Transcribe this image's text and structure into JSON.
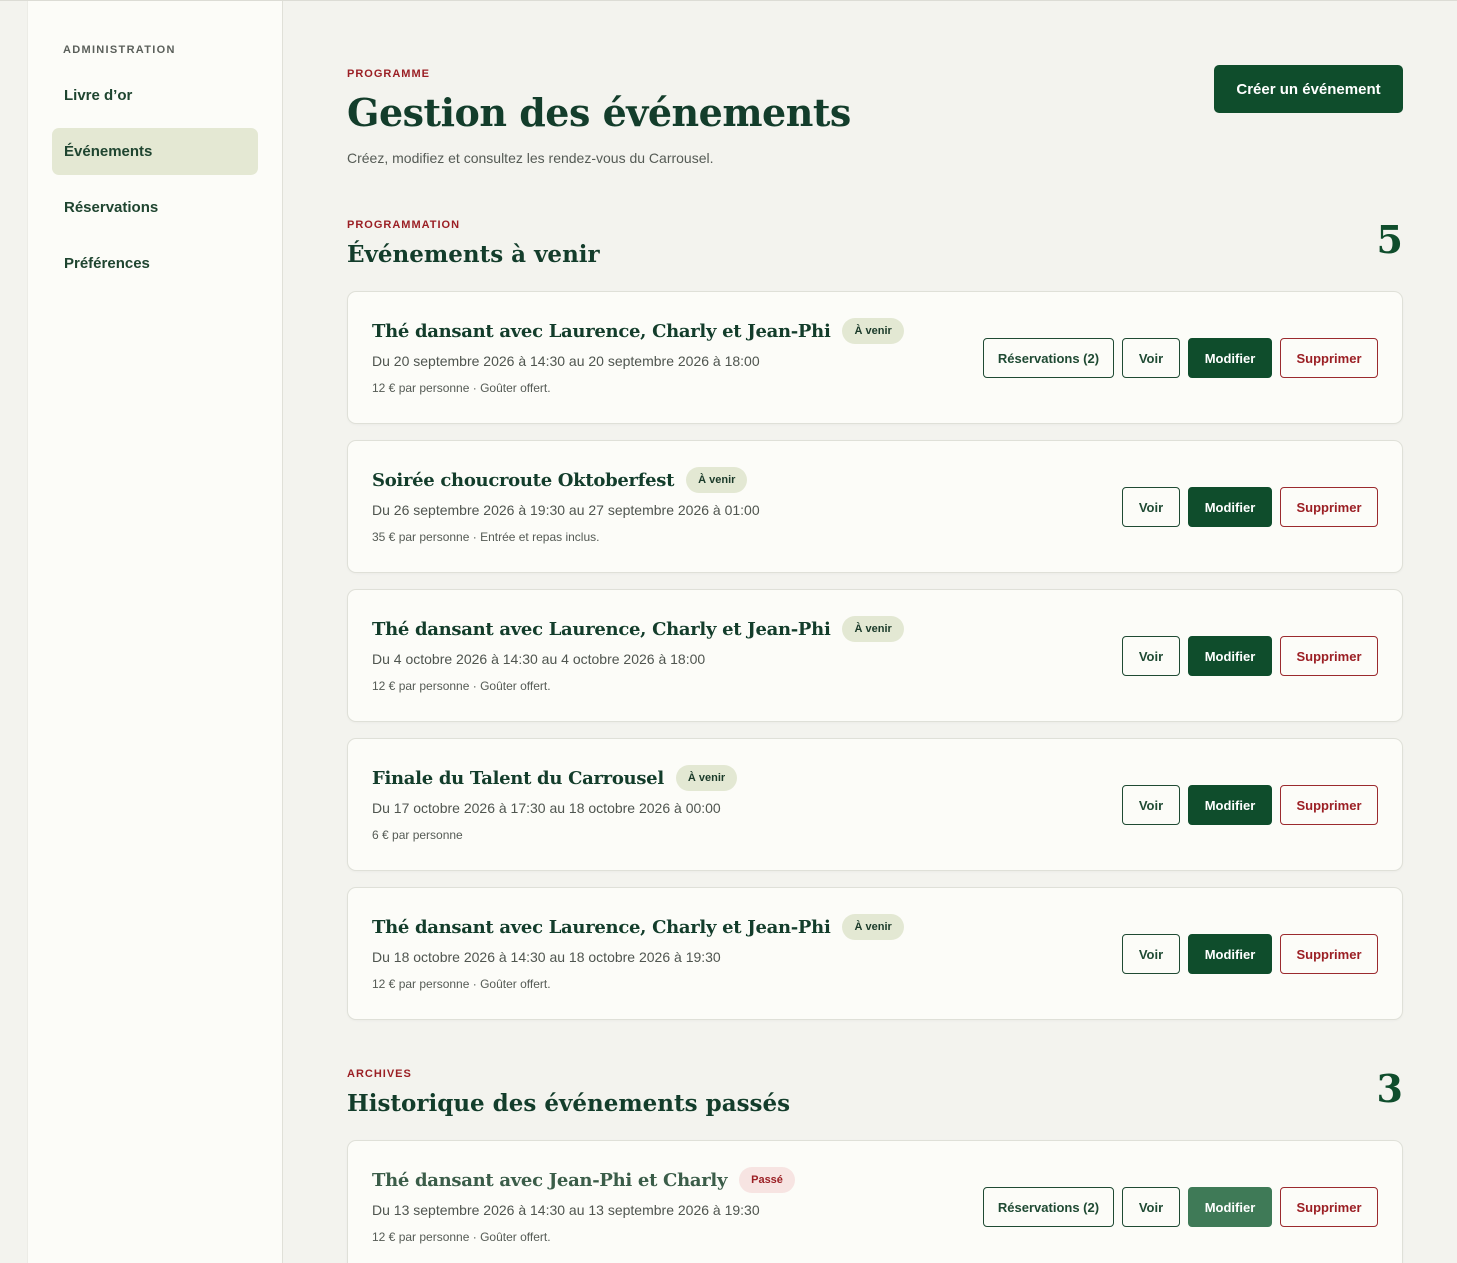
{
  "sidebar": {
    "heading": "ADMINISTRATION",
    "items": [
      {
        "label": "Livre d’or",
        "active": false
      },
      {
        "label": "Événements",
        "active": true
      },
      {
        "label": "Réservations",
        "active": false
      },
      {
        "label": "Préférences",
        "active": false
      }
    ]
  },
  "header": {
    "eyebrow": "PROGRAMME",
    "title": "Gestion des événements",
    "subtitle": "Créez, modifiez et consultez les rendez-vous du Carrousel.",
    "create_button": "Créer un événement"
  },
  "upcoming": {
    "eyebrow": "PROGRAMMATION",
    "title": "Événements à venir",
    "count": "5",
    "events": [
      {
        "title": "Thé dansant avec Laurence, Charly et Jean-Phi",
        "badge": "À venir",
        "dates": "Du 20 septembre 2026 à 14:30 au 20 septembre 2026 à 18:00",
        "info": "12 € par personne · Goûter offert.",
        "reservations": "Réservations (2)"
      },
      {
        "title": "Soirée choucroute Oktoberfest",
        "badge": "À venir",
        "dates": "Du 26 septembre 2026 à 19:30 au 27 septembre 2026 à 01:00",
        "info": "35 € par personne · Entrée et repas inclus."
      },
      {
        "title": "Thé dansant avec Laurence, Charly et Jean-Phi",
        "badge": "À venir",
        "dates": "Du 4 octobre 2026 à 14:30 au 4 octobre 2026 à 18:00",
        "info": "12 € par personne · Goûter offert."
      },
      {
        "title": "Finale du Talent du Carrousel",
        "badge": "À venir",
        "dates": "Du 17 octobre 2026 à 17:30 au 18 octobre 2026 à 00:00",
        "info": "6 € par personne"
      },
      {
        "title": "Thé dansant avec Laurence, Charly et Jean-Phi",
        "badge": "À venir",
        "dates": "Du 18 octobre 2026 à 14:30 au 18 octobre 2026 à 19:30",
        "info": "12 € par personne · Goûter offert."
      }
    ]
  },
  "archives": {
    "eyebrow": "ARCHIVES",
    "title": "Historique des événements passés",
    "count": "3",
    "events": [
      {
        "title": "Thé dansant avec Jean-Phi et Charly",
        "badge": "Passé",
        "dates": "Du 13 septembre 2026 à 14:30 au 13 septembre 2026 à 19:30",
        "info": "12 € par personne · Goûter offert.",
        "reservations": "Réservations (2)"
      }
    ]
  },
  "actions": {
    "view": "Voir",
    "edit": "Modifier",
    "delete": "Supprimer"
  },
  "colors": {
    "primary": "#0f4d2c",
    "accent_red": "#9b1f24",
    "active_nav_bg": "#e4e8d3",
    "page_bg": "#f3f3ee"
  }
}
